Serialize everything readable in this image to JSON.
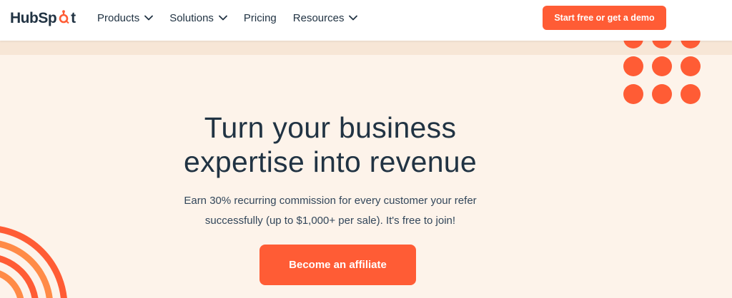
{
  "brand": {
    "logo_text_start": "HubSp",
    "logo_text_end": "t",
    "accent_color": "#ff5c35",
    "text_color": "#213343"
  },
  "nav": {
    "items": [
      {
        "label": "Products",
        "has_dropdown": true
      },
      {
        "label": "Solutions",
        "has_dropdown": true
      },
      {
        "label": "Pricing",
        "has_dropdown": false
      },
      {
        "label": "Resources",
        "has_dropdown": true
      }
    ],
    "cta_label": "Start free or get a demo"
  },
  "hero": {
    "headline_line1": "Turn your business",
    "headline_line2": "expertise into revenue",
    "subtext_line1": "Earn 30% recurring commission for every customer your refer",
    "subtext_line2": "successfully (up to $1,000+ per sale). It's free to join!",
    "cta_label": "Become an affiliate",
    "background_color": "#fdf3ea"
  }
}
